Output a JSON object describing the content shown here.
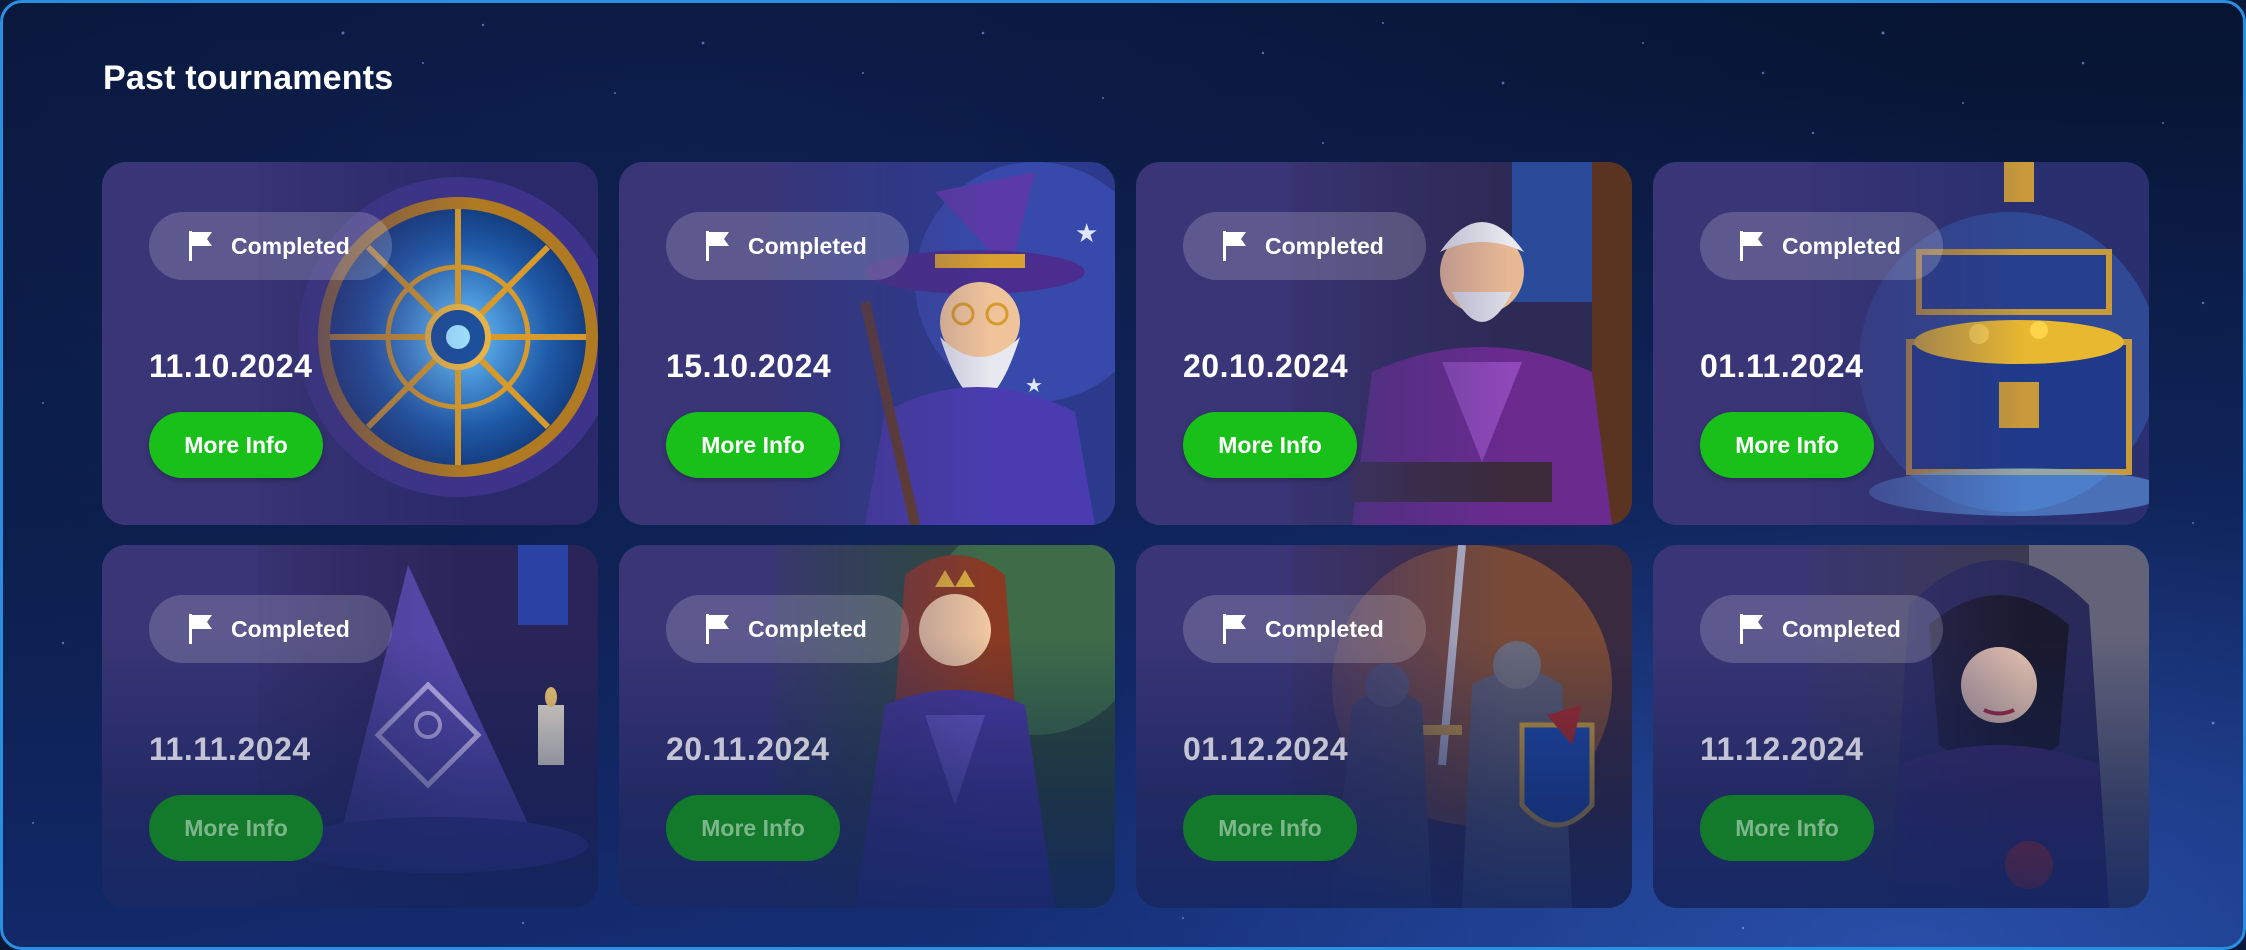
{
  "section": {
    "title": "Past tournaments"
  },
  "tournaments": [
    {
      "status": "Completed",
      "date": "11.10.2024",
      "button": "More Info",
      "art": "fortune-wheel"
    },
    {
      "status": "Completed",
      "date": "15.10.2024",
      "button": "More Info",
      "art": "wizard"
    },
    {
      "status": "Completed",
      "date": "20.10.2024",
      "button": "More Info",
      "art": "old-mage"
    },
    {
      "status": "Completed",
      "date": "01.11.2024",
      "button": "More Info",
      "art": "treasure-chest"
    },
    {
      "status": "Completed",
      "date": "11.11.2024",
      "button": "More Info",
      "art": "wizard-hat"
    },
    {
      "status": "Completed",
      "date": "20.11.2024",
      "button": "More Info",
      "art": "queen"
    },
    {
      "status": "Completed",
      "date": "01.12.2024",
      "button": "More Info",
      "art": "knights"
    },
    {
      "status": "Completed",
      "date": "11.12.2024",
      "button": "More Info",
      "art": "dark-sorceress"
    }
  ],
  "colors": {
    "accent_green": "#19c019",
    "border_blue": "#2a8fe0",
    "card_bg": "#3a3576"
  }
}
